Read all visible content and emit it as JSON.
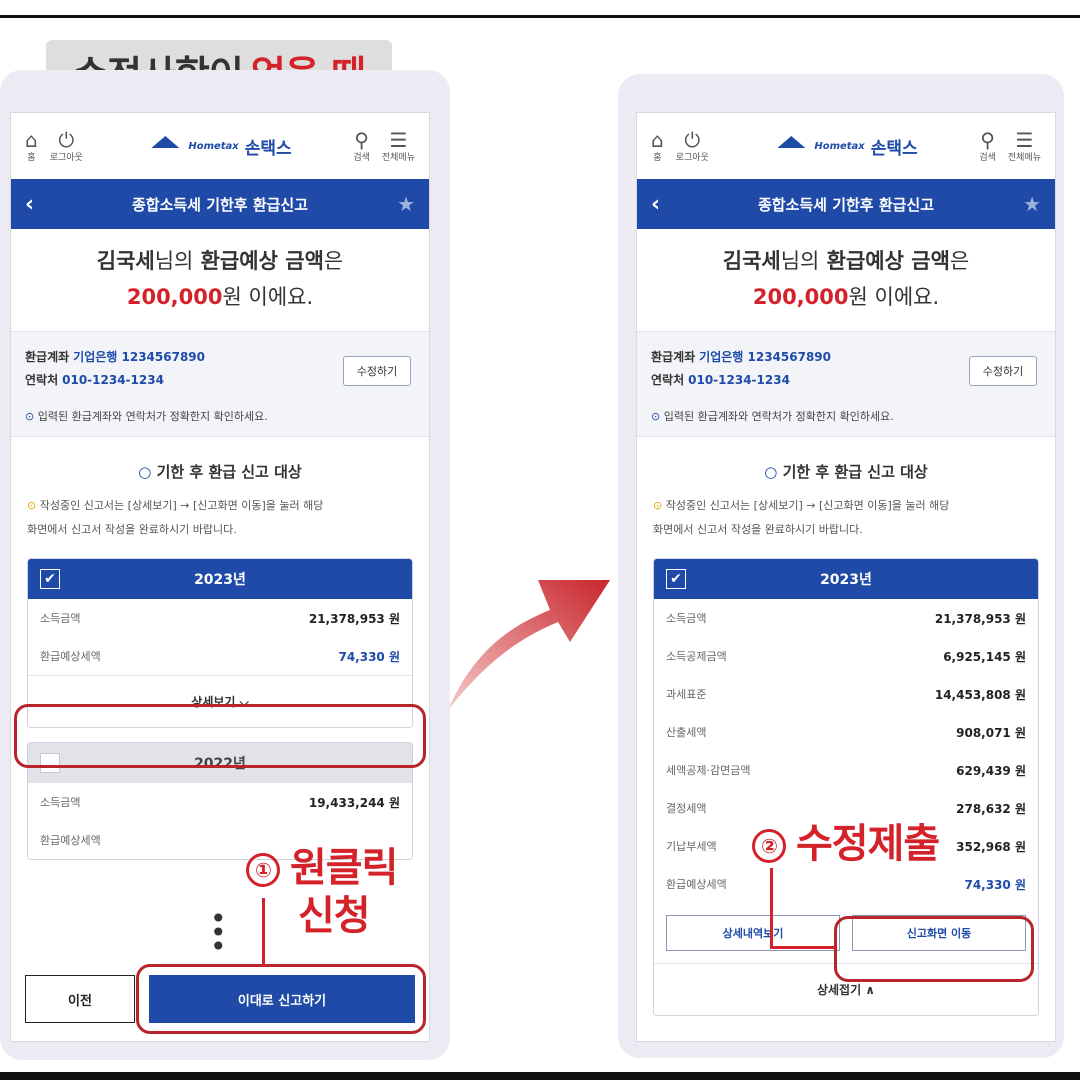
{
  "section_label": {
    "text": "수정사항이",
    "highlight": "없을 때"
  },
  "phone": {
    "home_label": "홈",
    "logout_label": "로그아웃",
    "brand": "손택스",
    "brand_logo": "Hometax",
    "search_label": "검색",
    "menu_label": "전체메뉴",
    "nav_title": "종합소득세 기한후 환급신고",
    "hero_line1_name": "김국세",
    "hero_line1_rest_a": "님의",
    "hero_line1_bold": "환급예상 금액",
    "hero_line1_end": "은",
    "hero_amount": "200,000",
    "hero_line2_end": "원 이에요.",
    "account_label": "환급계좌",
    "account_value": "기업은행 1234567890",
    "contact_label": "연락처",
    "contact_value": "010-1234-1234",
    "edit_button": "수정하기",
    "notice": "입력된 환급계좌와 연락처가 정확한지 확인하세요.",
    "target_title": "기한 후 환급 신고 대상",
    "guide_line1": "작성중인 신고서는 [상세보기] → [신고화면 이동]을 눌러 해당",
    "guide_line2": "화면에서 신고서 작성을 완료하시기 바랍니다."
  },
  "left": {
    "year2023": "2023년",
    "rows2023": [
      {
        "label": "소득금액",
        "value": "21,378,953 원"
      },
      {
        "label": "환급예상세액",
        "value": "74,330 원"
      }
    ],
    "detail_button": "상세보기 ⌵",
    "year2022": "2022년",
    "rows2022": [
      {
        "label": "소득금액",
        "value": "19,433,244 원"
      },
      {
        "label": "환급예상세액",
        "value": ""
      }
    ],
    "prev_button": "이전",
    "submit_button": "이대로 신고하기",
    "callout1_num": "①",
    "callout1_line1": "원클릭",
    "callout1_line2": "신청"
  },
  "right": {
    "year2023": "2023년",
    "rows": [
      {
        "label": "소득금액",
        "value": "21,378,953 원"
      },
      {
        "label": "소득공제금액",
        "value": "6,925,145 원"
      },
      {
        "label": "과세표준",
        "value": "14,453,808 원"
      },
      {
        "label": "산출세액",
        "value": "908,071 원"
      },
      {
        "label": "세액공제·감면금액",
        "value": "629,439 원"
      },
      {
        "label": "결정세액",
        "value": "278,632 원"
      },
      {
        "label": "기납부세액",
        "value": "352,968 원"
      },
      {
        "label": "환급예상세액",
        "value": "74,330 원"
      }
    ],
    "btn_detail_history": "상세내역보기",
    "btn_move": "신고화면 이동",
    "collapse_button": "상세접기 ∧",
    "callout2_num": "②",
    "callout2_text": "수정제출"
  }
}
